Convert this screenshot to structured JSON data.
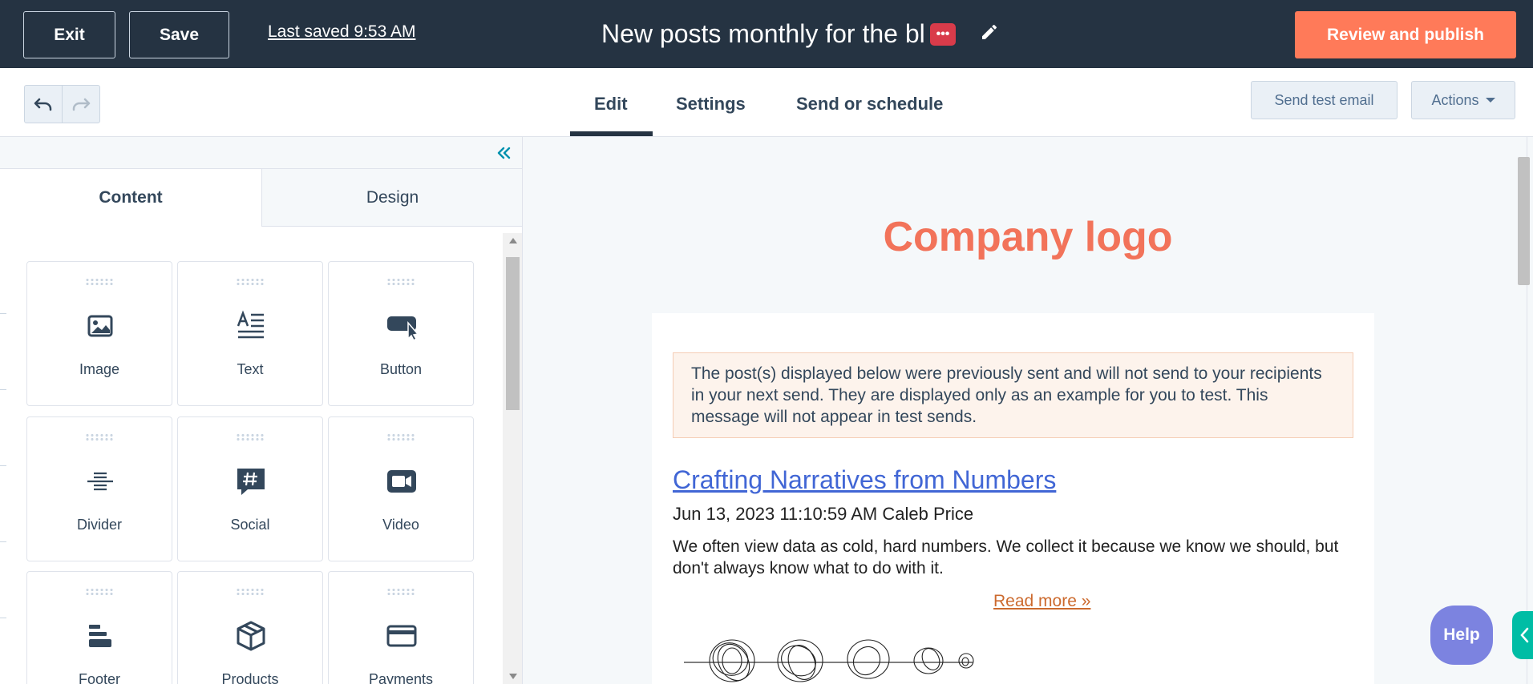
{
  "topbar": {
    "exit_label": "Exit",
    "save_label": "Save",
    "last_saved": "Last saved 9:53 AM",
    "email_title": "New posts monthly for the bl",
    "title_badge": "•••",
    "publish_label": "Review and publish"
  },
  "toolbar": {
    "tabs": [
      {
        "label": "Edit",
        "active": true
      },
      {
        "label": "Settings",
        "active": false
      },
      {
        "label": "Send or schedule",
        "active": false
      }
    ],
    "test_email_label": "Send test email",
    "actions_label": "Actions"
  },
  "left_panel": {
    "tabs": [
      {
        "label": "Content",
        "active": true
      },
      {
        "label": "Design",
        "active": false
      }
    ],
    "modules": [
      {
        "label": "Image",
        "icon": "image-icon"
      },
      {
        "label": "Text",
        "icon": "text-icon"
      },
      {
        "label": "Button",
        "icon": "button-icon"
      },
      {
        "label": "Divider",
        "icon": "divider-icon"
      },
      {
        "label": "Social",
        "icon": "social-icon"
      },
      {
        "label": "Video",
        "icon": "video-icon"
      },
      {
        "label": "Footer",
        "icon": "footer-icon"
      },
      {
        "label": "Products",
        "icon": "products-icon"
      },
      {
        "label": "Payments",
        "icon": "payments-icon"
      }
    ]
  },
  "preview": {
    "company_logo": "Company logo",
    "notice": "The post(s) displayed below were previously sent and will not send to your recipients in your next send. They are displayed only as an example for you to test. This message will not appear in test sends.",
    "post": {
      "title": "Crafting Narratives from Numbers",
      "meta": "Jun 13, 2023 11:10:59 AM Caleb Price",
      "excerpt": "We often view data as cold, hard numbers. We collect it because we know we should, but don't always know what to do with it.",
      "read_more": "Read more »"
    }
  },
  "help_label": "Help",
  "colors": {
    "topbar_bg": "#253342",
    "accent": "#ff7a59",
    "logo": "#f2735a",
    "link": "#4166d5",
    "help": "#7c83e0"
  }
}
